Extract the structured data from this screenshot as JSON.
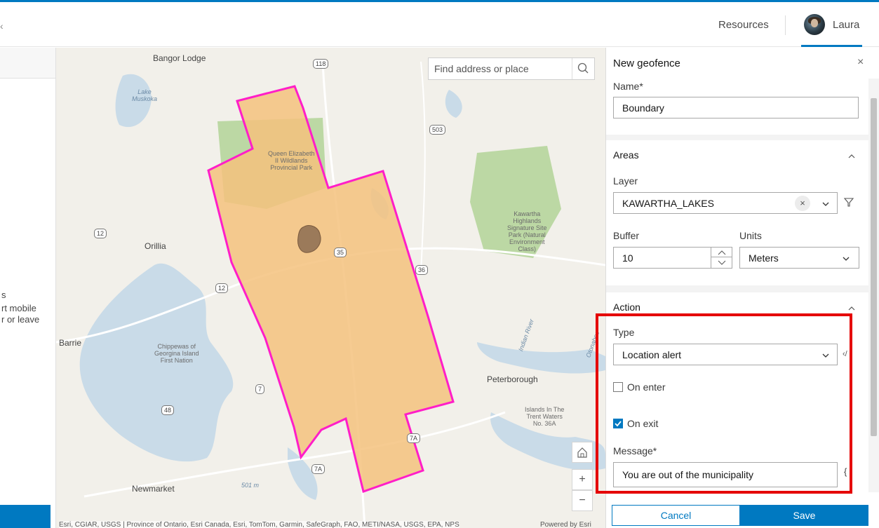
{
  "header": {
    "left_fragment": "‹",
    "resources_label": "Resources",
    "user_name": "Laura"
  },
  "left_panel": {
    "line1": "s",
    "line2": "rt mobile",
    "line3": "r or leave"
  },
  "map": {
    "search_placeholder": "Find address or place",
    "home_icon": "home-icon",
    "zoom_in": "+",
    "zoom_out": "−",
    "attribution": "Esri, CGIAR, USGS | Province of Ontario, Esri Canada, Esri, TomTom, Garmin, SafeGraph, FAO, METI/NASA, USGS, EPA, NPS",
    "powered_by": "Powered by Esri",
    "labels": {
      "bangor_lodge": "Bangor Lodge",
      "orillia": "Orillia",
      "barrie": "Barrie",
      "peterborough": "Peterborough",
      "newmarket": "Newmarket",
      "lake_muskoka": "Lake\nMuskoka",
      "queen_elizabeth": "Queen Elizabeth\nII Wildlands\nProvincial Park",
      "kawartha_highlands": "Kawartha\nHighlands\nSignature Site\nPark (Natural\nEnvironment\nClass)",
      "chippewas": "Chippewas of\nGeorgina Island\nFirst Nation",
      "islands_trent": "Islands In The\nTrent Waters\nNo. 36A",
      "indian_river": "Indian River",
      "otonabee": "Otonabee",
      "elevation": "501 m"
    },
    "shields": [
      "118",
      "503",
      "12",
      "12",
      "35",
      "36",
      "7",
      "48",
      "7A",
      "7A"
    ],
    "colors": {
      "geofence_fill": "#f5c27e",
      "geofence_stroke": "#ff1ec8",
      "water": "#c9dbe8",
      "park": "#bcd8a4"
    }
  },
  "panel": {
    "title": "New geofence",
    "close_icon": "close-icon",
    "name_label": "Name*",
    "name_value": "Boundary",
    "areas_title": "Areas",
    "layer_label": "Layer",
    "layer_value": "KAWARTHA_LAKES",
    "buffer_label": "Buffer",
    "buffer_value": "10",
    "units_label": "Units",
    "units_value": "Meters",
    "action_title": "Action",
    "type_label": "Type",
    "type_value": "Location alert",
    "on_enter_label": "On enter",
    "on_enter_checked": false,
    "on_exit_label": "On exit",
    "on_exit_checked": true,
    "message_label": "Message*",
    "message_value": "You are out of the municipality",
    "cancel_label": "Cancel",
    "save_label": "Save",
    "accent": "#0079c1",
    "highlight_color": "#e50000"
  }
}
